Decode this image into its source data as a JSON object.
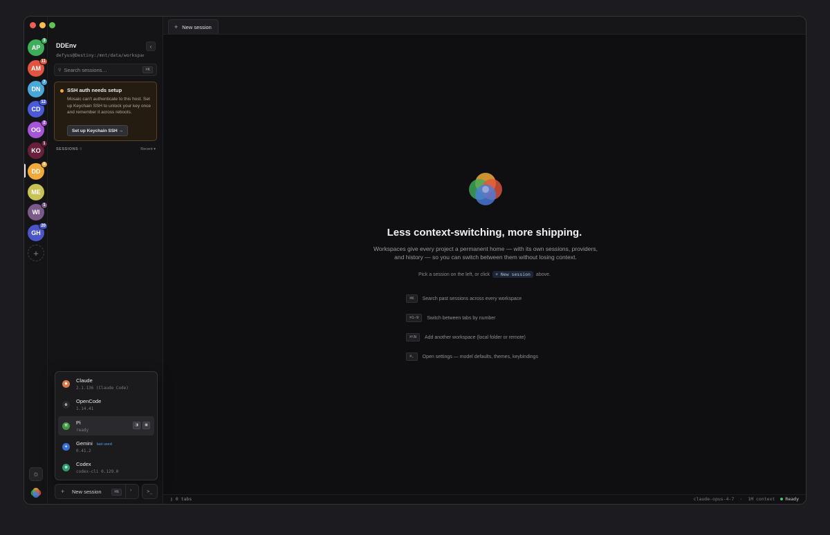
{
  "workspaces": [
    {
      "initials": "AP",
      "color": "#3fae5a",
      "badge": "3",
      "badge_color": "#3fae5a"
    },
    {
      "initials": "AM",
      "color": "#e0553f",
      "badge": "11",
      "badge_color": "#e0553f"
    },
    {
      "initials": "DN",
      "color": "#4aa8d8",
      "badge": "7",
      "badge_color": "#4aa8d8"
    },
    {
      "initials": "CD",
      "color": "#4b5bd8",
      "badge": "12",
      "badge_color": "#4b5bd8"
    },
    {
      "initials": "OG",
      "color": "#a655d8",
      "badge": "2",
      "badge_color": "#a655d8"
    },
    {
      "initials": "KO",
      "color": "#6a1f3a",
      "badge": "1",
      "badge_color": "#6a1f3a"
    },
    {
      "initials": "DD",
      "color": "#f0a93a",
      "badge": "8",
      "badge_color": "#f0a93a"
    },
    {
      "initials": "ME",
      "color": "#c9c255",
      "badge": "",
      "badge_color": ""
    },
    {
      "initials": "WI",
      "color": "#7a5a8a",
      "badge": "1",
      "badge_color": "#7a5a8a"
    },
    {
      "initials": "GH",
      "color": "#4a55c8",
      "badge": "20",
      "badge_color": "#4a55c8"
    }
  ],
  "add_workspace": "+",
  "sidebar": {
    "title": "DDEnv",
    "subtitle": "defyus@Destiny:/mnt/data/workspace",
    "search_placeholder": "Search sessions…",
    "search_shortcut": "⌘K",
    "alert": {
      "title": "SSH auth needs setup",
      "body": "Mosaic can't authenticate to this host. Set up Keychain SSH to unlock your key once and remember it across reboots.",
      "button": "Set up Keychain SSH →"
    },
    "sessions_label": "SESSIONS",
    "sessions_count": "0",
    "sort_label": "Recent ▾"
  },
  "providers": [
    {
      "name": "Claude",
      "version": "2.1.136 (Claude Code)",
      "icon_color": "#d8784a",
      "icon": "✸",
      "tag": ""
    },
    {
      "name": "OpenCode",
      "version": "1.14.41",
      "icon_color": "#2a2a2e",
      "icon": "o",
      "tag": ""
    },
    {
      "name": "Pi",
      "version": "ready",
      "icon_color": "#3e9a3e",
      "icon": "π",
      "tag": "",
      "hover": true
    },
    {
      "name": "Gemini",
      "version": "0.41.2",
      "icon_color": "#3b6fd8",
      "icon": "✦",
      "tag": "last used"
    },
    {
      "name": "Codex",
      "version": "codex-cli 0.129.0",
      "icon_color": "#2e9a70",
      "icon": "❋",
      "tag": ""
    }
  ],
  "new_session": {
    "label": "New session",
    "shortcut": "⌘N",
    "chevron": "›",
    "terminal": ">_"
  },
  "tab": {
    "label": "New session",
    "plus": "+"
  },
  "hero": {
    "title": "Less context-switching, more shipping.",
    "text": "Workspaces give every project a permanent home — with its own sessions, providers, and history — so you can switch between them without losing context.",
    "hint_pre": "Pick a session on the left, or click",
    "hint_chip": "+ New session",
    "hint_post": "above."
  },
  "shortcuts": [
    {
      "key": "⌘K",
      "desc": "Search past sessions across every workspace"
    },
    {
      "key": "⌘1–9",
      "desc": "Switch between tabs by number"
    },
    {
      "key": "⌘⌥N",
      "desc": "Add another workspace (local folder or remote)"
    },
    {
      "key": "⌘,",
      "desc": "Open settings — model defaults, themes, keybindings"
    }
  ],
  "status": {
    "tabs": "0 tabs",
    "model": "claude-opus-4-7",
    "separator": "·",
    "context": "1M context",
    "state": "Ready"
  },
  "colors": {
    "accent": "#f0a93a",
    "ready": "#4cc374"
  }
}
